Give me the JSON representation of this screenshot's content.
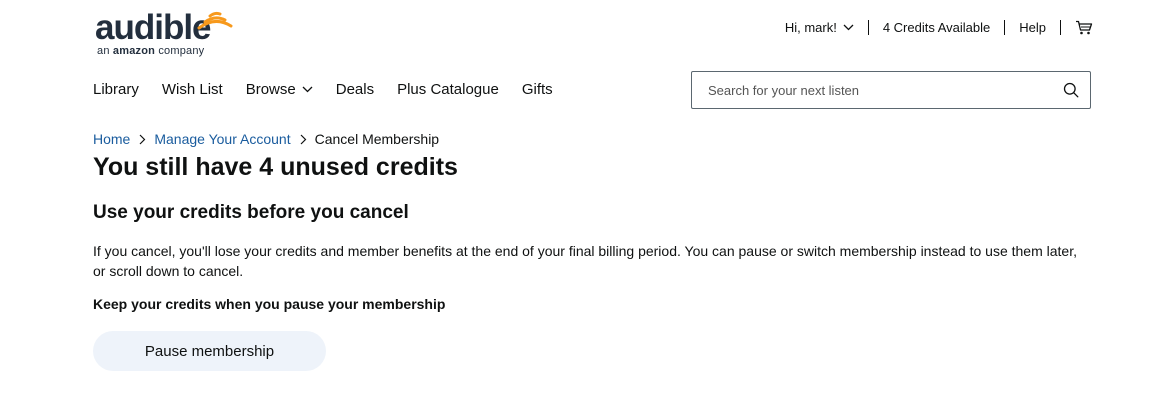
{
  "brand": {
    "wordmark": "audible",
    "tagline_prefix": "an ",
    "tagline_brand": "amazon",
    "tagline_suffix": " company",
    "accent_color": "#f7991c"
  },
  "topbar": {
    "greeting": "Hi, mark!",
    "credits": "4 Credits Available",
    "help": "Help",
    "cart_icon": "cart-icon"
  },
  "nav": {
    "items": [
      "Library",
      "Wish List",
      "Browse",
      "Deals",
      "Plus Catalogue",
      "Gifts"
    ]
  },
  "search": {
    "placeholder": "Search for your next listen",
    "icon": "search-icon"
  },
  "breadcrumb": {
    "home": "Home",
    "account": "Manage Your Account",
    "current": "Cancel Membership"
  },
  "content": {
    "title": "You still have 4 unused credits",
    "subtitle": "Use your credits before you cancel",
    "body": "If you cancel, you'll lose your credits and member benefits at the end of your final billing period. You can pause or switch membership instead to use them later, or scroll down to cancel.",
    "keep_heading": "Keep your credits when you pause your membership",
    "pause_button": "Pause membership"
  }
}
